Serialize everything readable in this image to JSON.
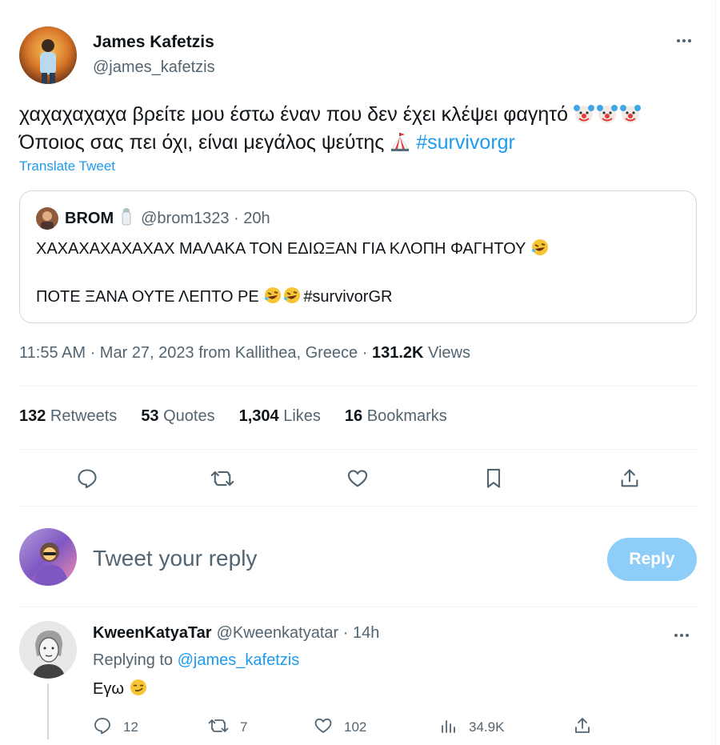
{
  "tweet": {
    "author": {
      "name": "James Kafetzis",
      "handle": "@james_kafetzis"
    },
    "text_line1": "χαχαχαχαχα βρείτε μου έστω έναν που δεν έχει κλέψει φαγητό",
    "text_line2": "Όποιος σας πει όχι, είναι μεγάλος ψεύτης",
    "hashtag": "#survivorgr",
    "translate_label": "Translate Tweet",
    "quote": {
      "name": "BROM",
      "handle_time": "@brom1323 · 20h",
      "line1": "ΧΑΧΑΧΑΧΑΧΑΧΑΧ ΜΑΛΑΚΑ ΤΟΝ ΕΔΙΩΞΑΝ ΓΙΑ ΚΛΟΠΗ ΦΑΓΗΤΟΥ",
      "line2": "ΠΟΤΕ ΞΑΝΑ ΟΥΤΕ ΛΕΠΤΟ ΡΕ",
      "line2_hashtag": "#survivorGR"
    },
    "meta": {
      "timestamp": "11:55 AM · Mar 27, 2023 from Kallithea, Greece · ",
      "views_count": "131.2K",
      "views_label": " Views"
    },
    "stats": {
      "retweets_count": "132",
      "retweets_label": " Retweets",
      "quotes_count": "53",
      "quotes_label": " Quotes",
      "likes_count": "1,304",
      "likes_label": " Likes",
      "bookmarks_count": "16",
      "bookmarks_label": " Bookmarks"
    }
  },
  "composer": {
    "placeholder": "Tweet your reply",
    "button_label": "Reply"
  },
  "reply": {
    "name": "KweenKatyaTar",
    "handle_time": "@Kweenkatyatar · 14h",
    "replying_prefix": "Replying to ",
    "replying_to": "@james_kafetzis",
    "text": "Εγω",
    "counts": {
      "replies": "12",
      "retweets": "7",
      "likes": "102",
      "views": "34.9K"
    }
  },
  "colors": {
    "accent": "#1d9bf0",
    "reply_button": "#8ecdf7",
    "secondary_text": "#536471",
    "border": "#cfd9de"
  },
  "icons": [
    "more-icon",
    "clown-emoji",
    "circus-tent-emoji",
    "salt-shaker-emoji",
    "rofl-emoji",
    "smirk-emoji",
    "reply-icon",
    "retweet-icon",
    "like-icon",
    "bookmark-icon",
    "share-icon",
    "views-icon"
  ]
}
